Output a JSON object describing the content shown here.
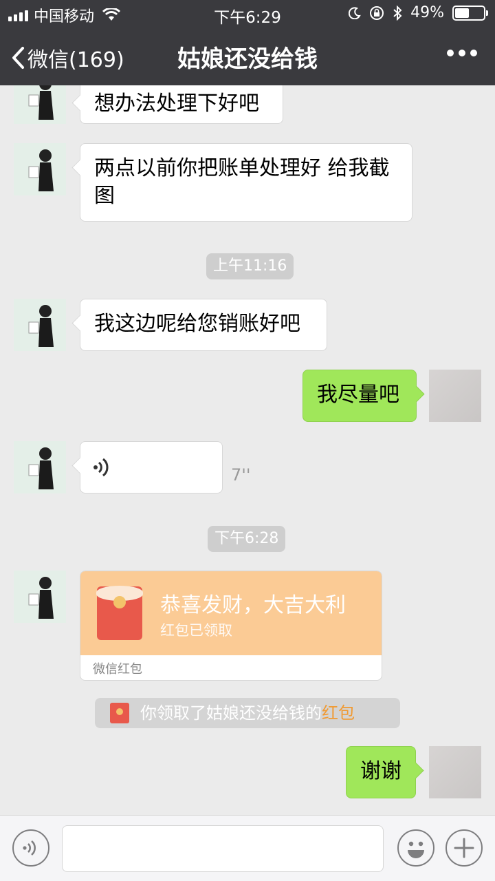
{
  "status_bar": {
    "carrier": "中国移动",
    "time": "下午6:29",
    "battery": "49%",
    "battery_level": 0.49
  },
  "nav": {
    "back_label": "微信(169)",
    "title": "姑娘还没给钱"
  },
  "messages": {
    "m1": "想办法处理下好吧",
    "m2_line1": "两点以前你把账单处理好 给我截",
    "m2_line2": "图",
    "time1": "上午11:16",
    "m3": "我这边呢给您销账好吧",
    "m4": "我尽量吧",
    "voice_duration": "7''",
    "time2": "下午6:28",
    "m7": "谢谢"
  },
  "red_packet": {
    "title": "恭喜发财，大吉大利",
    "status": "红包已领取",
    "footer": "微信红包"
  },
  "system_notice": {
    "prefix": "你领取了姑娘还没给钱的",
    "highlight": "红包"
  },
  "colors": {
    "nav_bg": "#3a3a3e",
    "chat_bg": "#ebebeb",
    "my_bubble": "#a0e75a",
    "red_packet_bg": "#fbcb95",
    "highlight_orange": "#f09a33"
  }
}
